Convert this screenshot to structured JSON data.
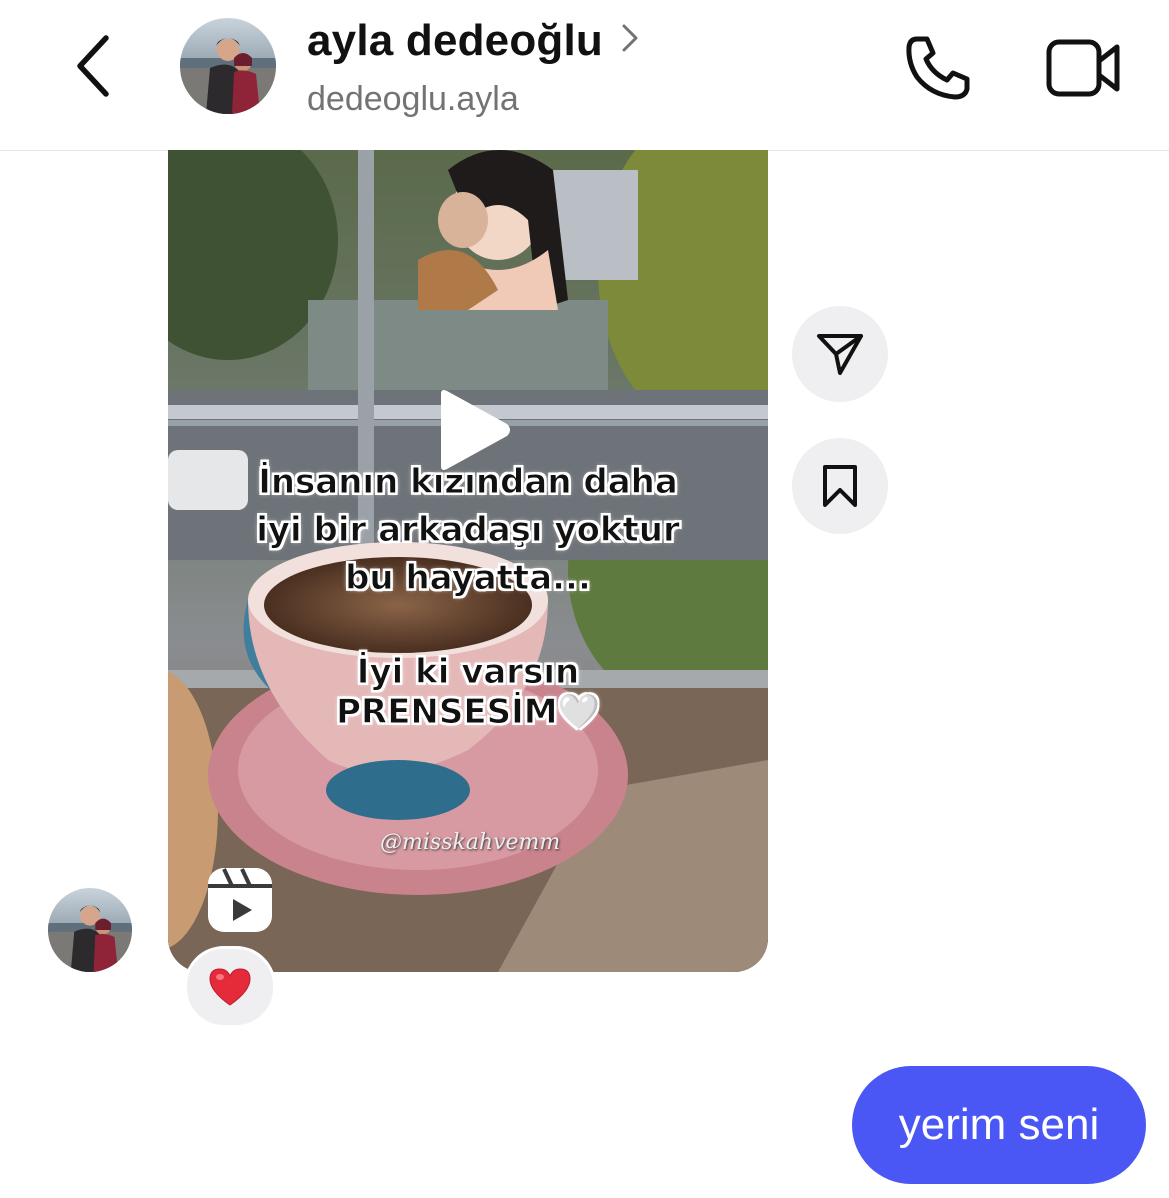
{
  "header": {
    "name": "ayla dedeoğlu",
    "username": "dedeoglu.ayla",
    "back_icon": "chevron-left-icon",
    "profile_chevron_icon": "chevron-right-icon",
    "call_icon": "phone-icon",
    "video_icon": "video-camera-icon"
  },
  "reel": {
    "overlay_lines": [
      "İnsanın kızından daha",
      "iyi bir arkadaşı yoktur",
      "bu hayatta...",
      "İyi ki varsın",
      "PRENSESİM🤍"
    ],
    "watermark": "@misskahvemm",
    "play_icon": "play-icon",
    "type_icon": "reels-icon"
  },
  "actions": {
    "share_icon": "paper-plane-icon",
    "save_icon": "bookmark-icon"
  },
  "reaction": {
    "emoji": "❤️"
  },
  "messages": [
    {
      "from": "me",
      "text": "yerim seni"
    }
  ],
  "colors": {
    "bubble": "#4b57f5",
    "action_bg": "#efeff1",
    "secondary_text": "#737373"
  }
}
